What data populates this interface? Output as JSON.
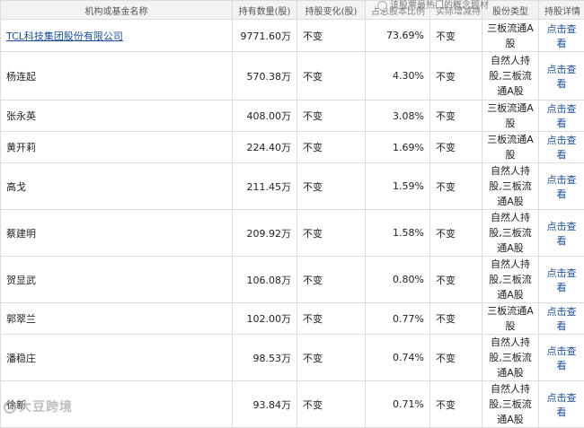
{
  "header": {
    "columns": [
      "机构或基金名称",
      "持有数量(股)",
      "持股变化(股)",
      "占总股本比例",
      "实际增减持",
      "股份类型",
      "持股详情"
    ]
  },
  "overlay_text": "该股票最热门的概念题材",
  "rows": [
    {
      "name": "TCL科技集团股份有限公司",
      "qty": "9771.60万",
      "change": "不变",
      "ratio": "73.69%",
      "actual": "不变",
      "type_lines": [
        "三板流通A",
        "股"
      ],
      "detail": "点击查看"
    },
    {
      "name": "杨连起",
      "qty": "570.38万",
      "change": "不变",
      "ratio": "4.30%",
      "actual": "不变",
      "type_lines": [
        "自然人持",
        "股,三板流",
        "通A股"
      ],
      "detail": "点击查看"
    },
    {
      "name": "张永英",
      "qty": "408.00万",
      "change": "不变",
      "ratio": "3.08%",
      "actual": "不变",
      "type_lines": [
        "三板流通A",
        "股"
      ],
      "detail": "点击查看"
    },
    {
      "name": "黄开莉",
      "qty": "224.40万",
      "change": "不变",
      "ratio": "1.69%",
      "actual": "不变",
      "type_lines": [
        "三板流通A",
        "股"
      ],
      "detail": "点击查看"
    },
    {
      "name": "高戈",
      "qty": "211.45万",
      "change": "不变",
      "ratio": "1.59%",
      "actual": "不变",
      "type_lines": [
        "自然人持",
        "股,三板流",
        "通A股"
      ],
      "detail": "点击查看"
    },
    {
      "name": "蔡建明",
      "qty": "209.92万",
      "change": "不变",
      "ratio": "1.58%",
      "actual": "不变",
      "type_lines": [
        "自然人持",
        "股,三板流",
        "通A股"
      ],
      "detail": "点击查看"
    },
    {
      "name": "贺显武",
      "qty": "106.08万",
      "change": "不变",
      "ratio": "0.80%",
      "actual": "不变",
      "type_lines": [
        "自然人持",
        "股,三板流",
        "通A股"
      ],
      "detail": "点击查看"
    },
    {
      "name": "郭翠兰",
      "qty": "102.00万",
      "change": "不变",
      "ratio": "0.77%",
      "actual": "不变",
      "type_lines": [
        "三板流通A",
        "股"
      ],
      "detail": "点击查看"
    },
    {
      "name": "潘稳庄",
      "qty": "98.53万",
      "change": "不变",
      "ratio": "0.74%",
      "actual": "不变",
      "type_lines": [
        "自然人持",
        "股,三板流",
        "通A股"
      ],
      "detail": "点击查看"
    },
    {
      "name": "徐新",
      "qty": "93.84万",
      "change": "不变",
      "ratio": "0.71%",
      "actual": "不变",
      "type_lines": [
        "自然人持",
        "股,三板流",
        "通A股"
      ],
      "detail": "点击查看"
    }
  ],
  "watermark": "大豆跨境"
}
